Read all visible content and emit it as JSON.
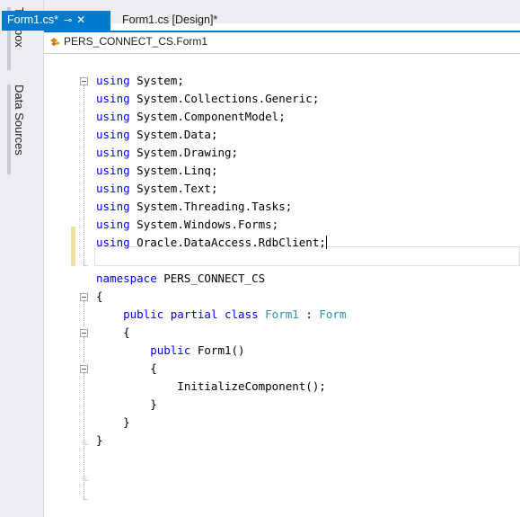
{
  "side_panel": {
    "toolbox_label": "Toolbox",
    "datasources_label": "Data Sources"
  },
  "tabs": {
    "active_label": "Form1.cs*",
    "pin_glyph": "⊸",
    "close_glyph": "✕",
    "inactive_label": "Form1.cs [Design]*"
  },
  "nav": {
    "class_path": "PERS_CONNECT_CS.Form1",
    "icon": "class-icon"
  },
  "colors": {
    "accent": "#007acc",
    "keyword": "#0000ff",
    "type": "#2b91af",
    "change_marker": "#efe29f"
  },
  "code": {
    "lines": [
      {
        "k": "using",
        "t": " System;"
      },
      {
        "k": "using",
        "t": " System.Collections.Generic;"
      },
      {
        "k": "using",
        "t": " System.ComponentModel;"
      },
      {
        "k": "using",
        "t": " System.Data;"
      },
      {
        "k": "using",
        "t": " System.Drawing;"
      },
      {
        "k": "using",
        "t": " System.Linq;"
      },
      {
        "k": "using",
        "t": " System.Text;"
      },
      {
        "k": "using",
        "t": " System.Threading.Tasks;"
      },
      {
        "k": "using",
        "t": " System.Windows.Forms;"
      },
      {
        "k": "using",
        "t": " Oracle.DataAccess.RdbClient;"
      },
      {
        "k": "",
        "t": ""
      },
      {
        "k": "namespace",
        "t": " PERS_CONNECT_CS"
      },
      {
        "k": "",
        "t": "{"
      },
      {
        "k": "    public partial class",
        "t": " ",
        "ty": "Form1",
        "t2": " : ",
        "ty2": "Form"
      },
      {
        "k": "",
        "t": "    {"
      },
      {
        "k": "        public",
        "t": " Form1()"
      },
      {
        "k": "",
        "t": "        {"
      },
      {
        "k": "",
        "t": "            InitializeComponent();"
      },
      {
        "k": "",
        "t": "        }"
      },
      {
        "k": "",
        "t": "    }"
      },
      {
        "k": "",
        "t": "}"
      }
    ]
  }
}
